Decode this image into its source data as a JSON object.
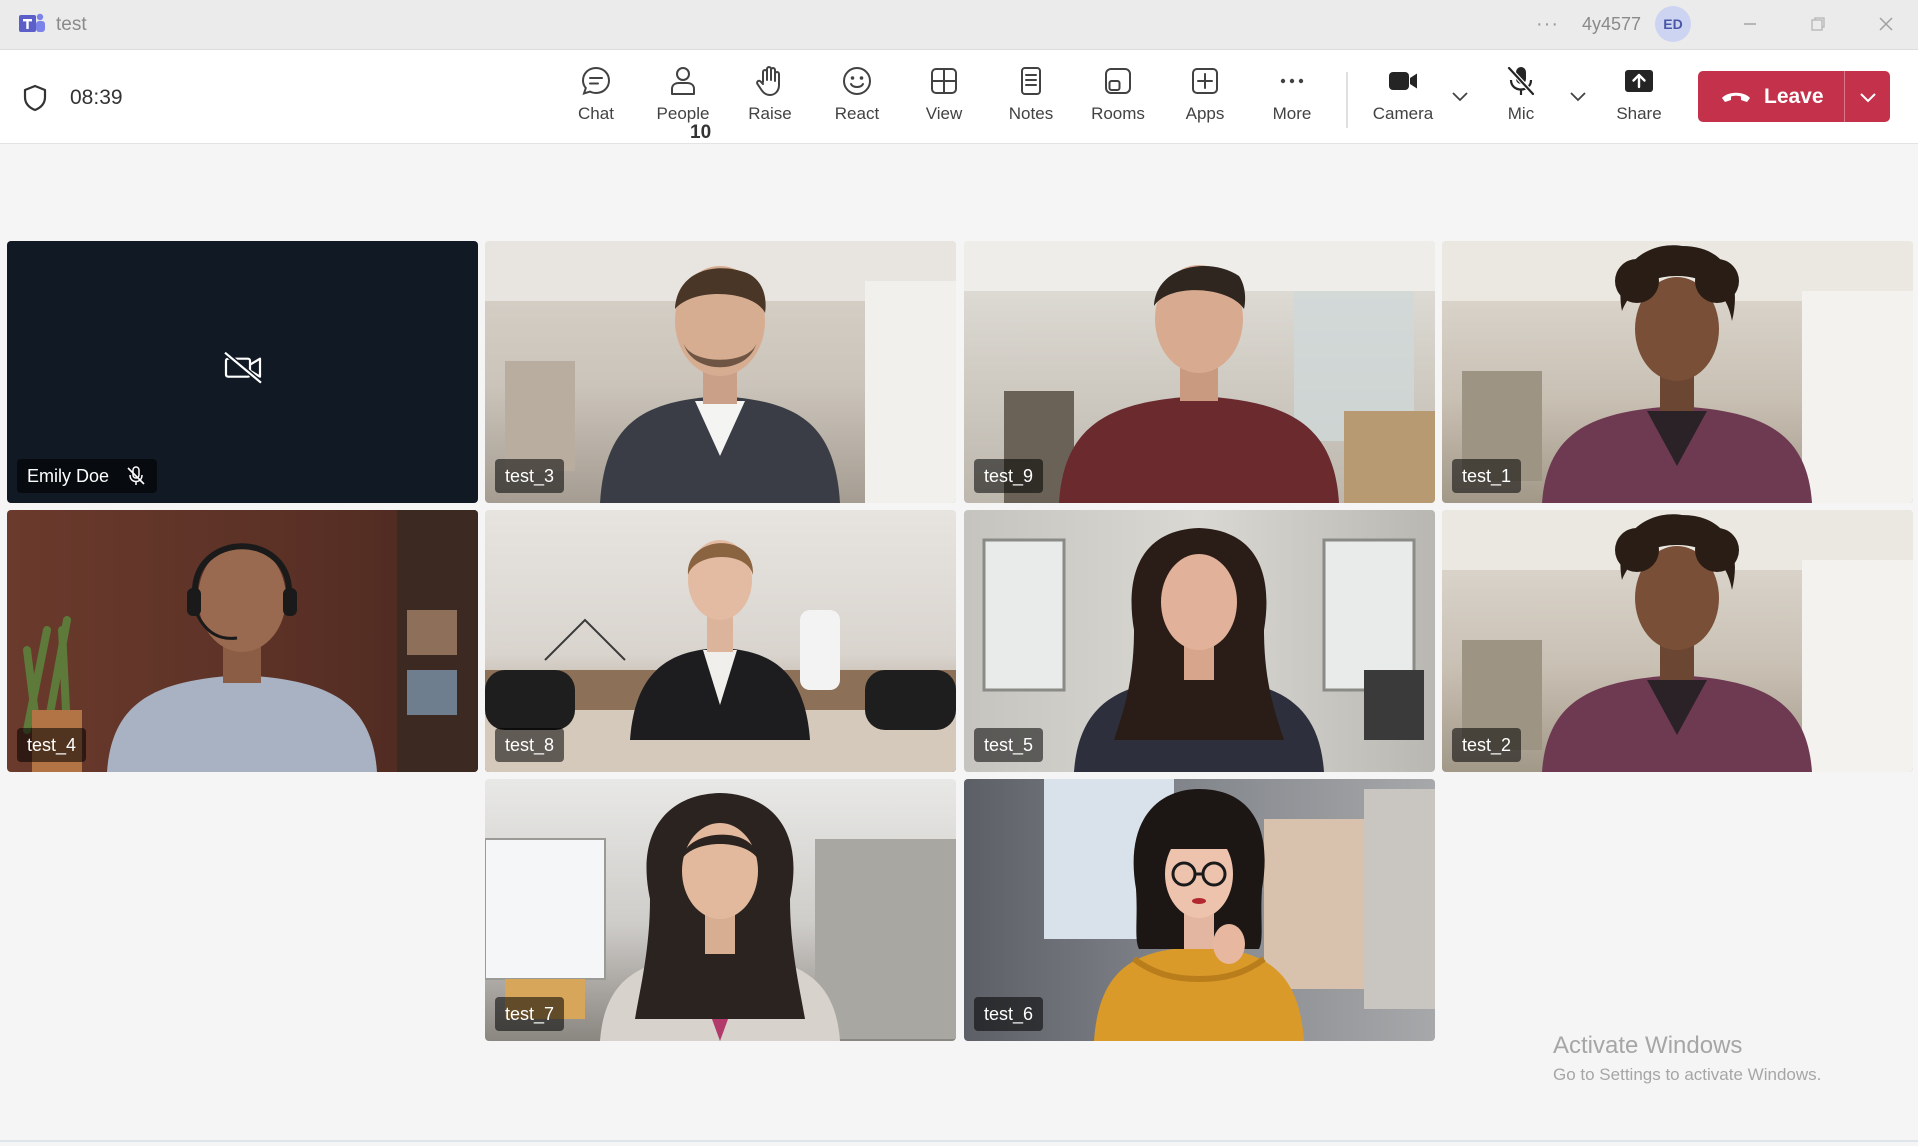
{
  "window": {
    "title": "test",
    "account_code": "4y4577",
    "avatar_initials": "ED",
    "more_dots": "···"
  },
  "meeting": {
    "elapsed": "08:39"
  },
  "toolbar": {
    "chat": "Chat",
    "people": "People",
    "people_count": "10",
    "raise": "Raise",
    "react": "React",
    "view": "View",
    "notes": "Notes",
    "rooms": "Rooms",
    "apps": "Apps",
    "more": "More",
    "camera": "Camera",
    "mic": "Mic",
    "share": "Share",
    "leave": "Leave"
  },
  "tiles": [
    {
      "name": "Emily Doe",
      "camera": "off",
      "mic": "muted"
    },
    {
      "name": "test_3"
    },
    {
      "name": "test_9"
    },
    {
      "name": "test_1"
    },
    {
      "name": "test_4"
    },
    {
      "name": "test_8"
    },
    {
      "name": "test_5"
    },
    {
      "name": "test_2"
    },
    {
      "name": "test_7"
    },
    {
      "name": "test_6"
    }
  ],
  "watermark": {
    "title": "Activate Windows",
    "subtitle": "Go to Settings to activate Windows."
  },
  "colors": {
    "leave": "#c4314b",
    "brand": "#5b5fc7",
    "camera_off_tile": "#111a24"
  },
  "icons": [
    "teams-logo-icon",
    "shield-icon",
    "chat-icon",
    "people-icon",
    "raise-hand-icon",
    "react-icon",
    "view-icon",
    "notes-icon",
    "rooms-icon",
    "apps-icon",
    "more-icon",
    "camera-icon",
    "mic-off-icon",
    "share-icon",
    "phone-hangup-icon",
    "chevron-down-icon",
    "camera-off-icon"
  ]
}
